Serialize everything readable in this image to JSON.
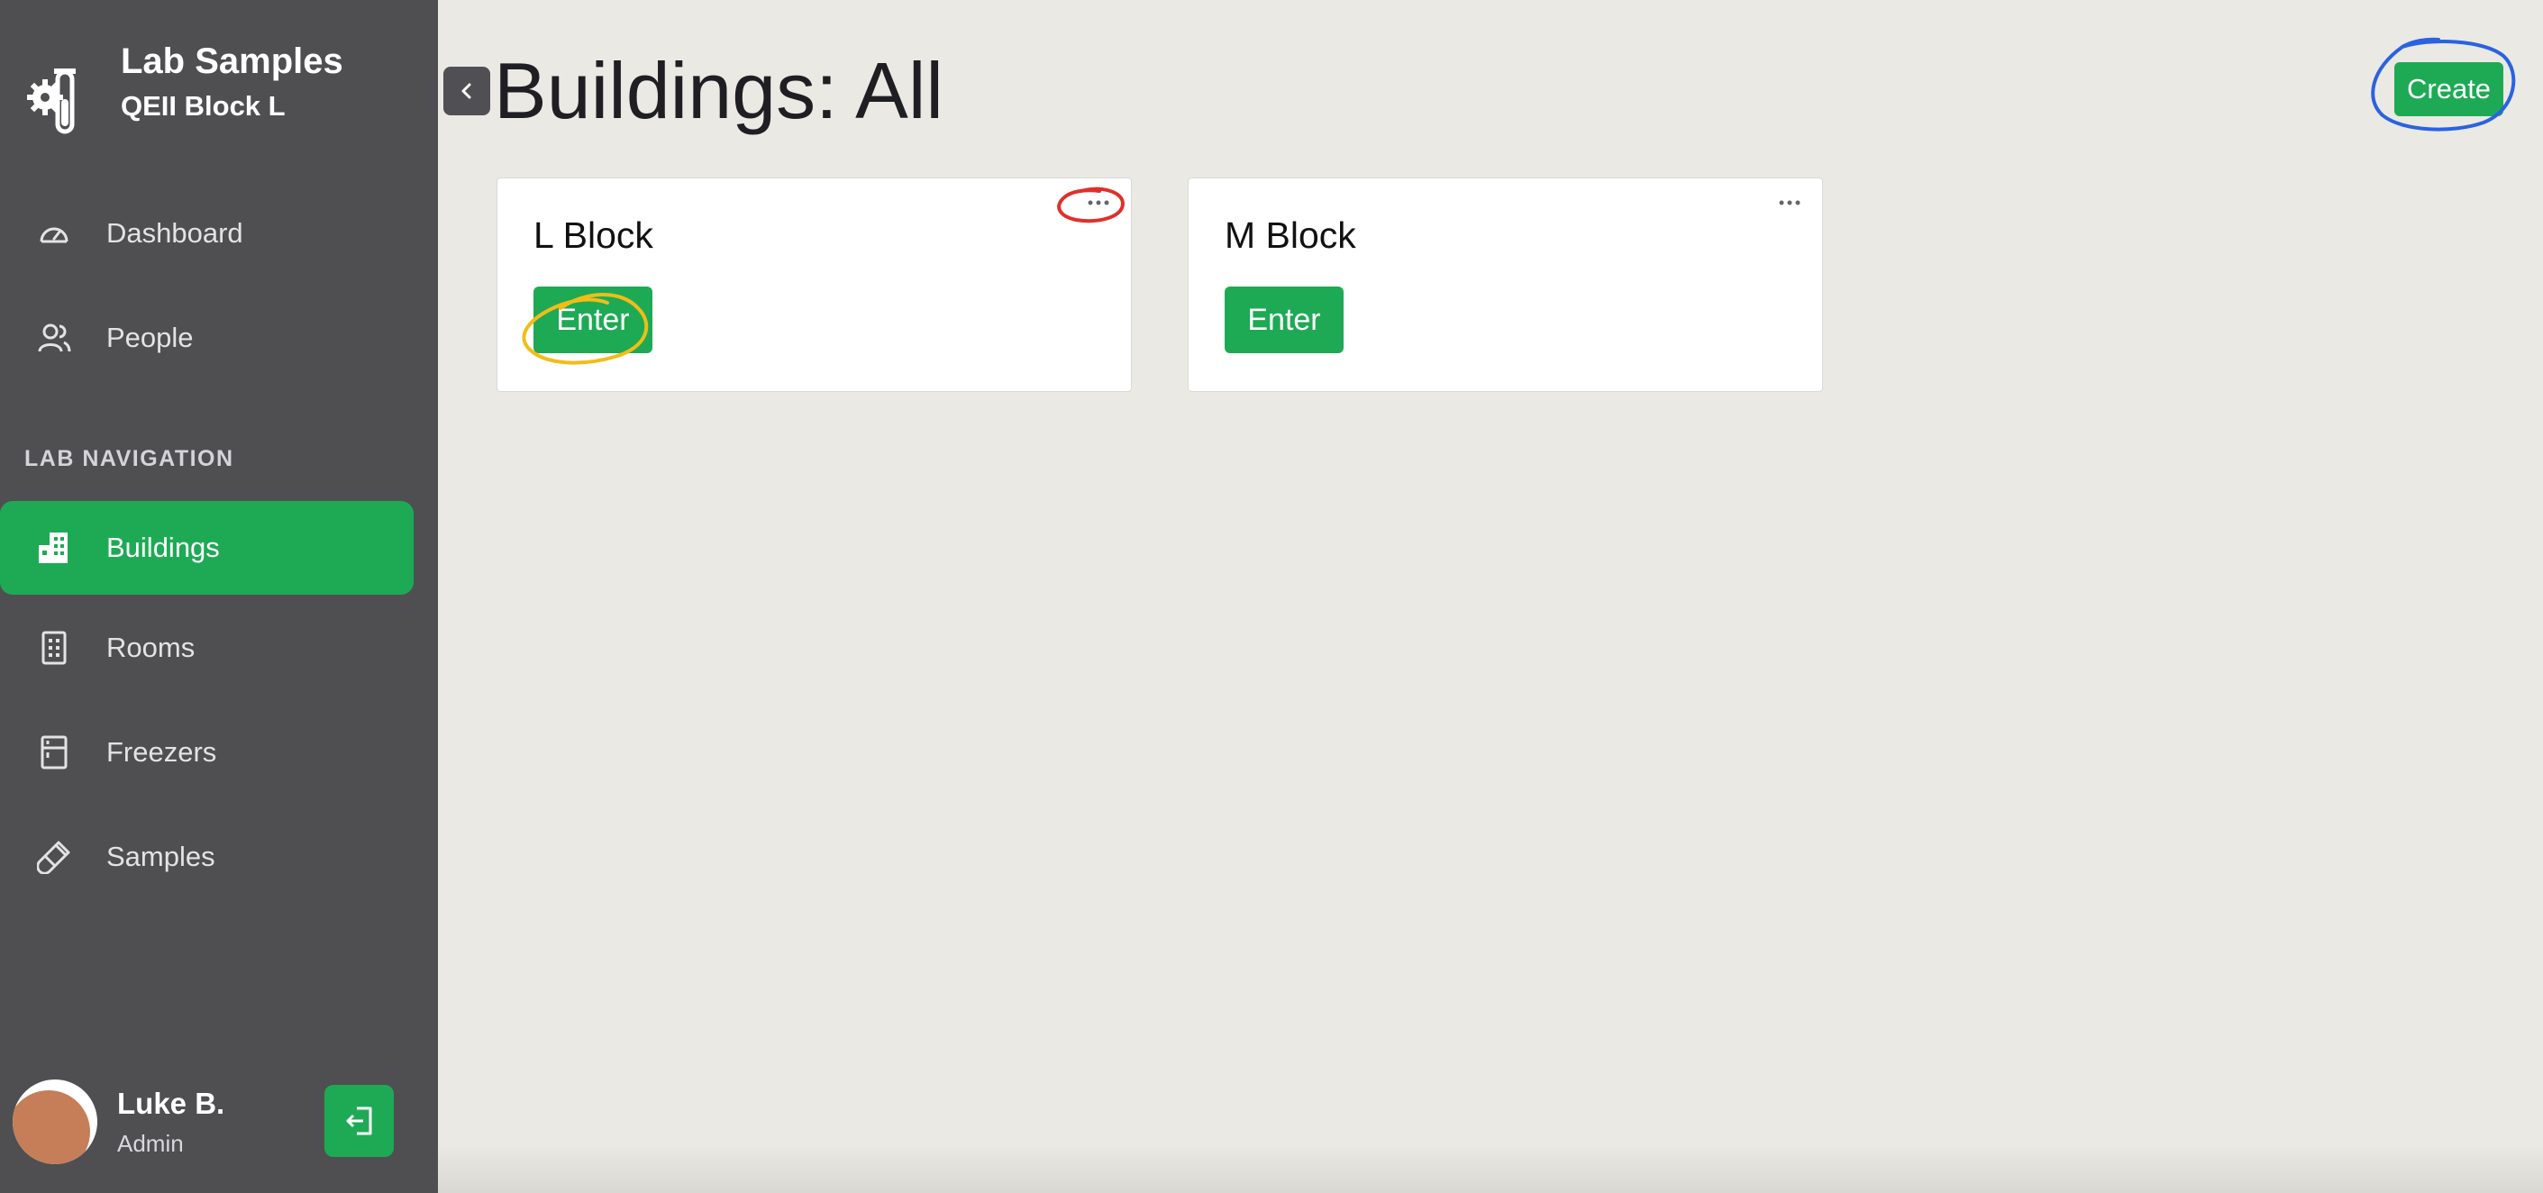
{
  "brand": {
    "title": "Lab Samples",
    "subtitle": "QEII Block L"
  },
  "nav": {
    "dashboard": "Dashboard",
    "people": "People",
    "section_label": "LAB NAVIGATION",
    "buildings": "Buildings",
    "rooms": "Rooms",
    "freezers": "Freezers",
    "samples": "Samples"
  },
  "user": {
    "name": "Luke B.",
    "role": "Admin"
  },
  "page": {
    "title": "Buildings: All",
    "create_label": "Create"
  },
  "cards": [
    {
      "title": "L Block",
      "enter_label": "Enter"
    },
    {
      "title": "M Block",
      "enter_label": "Enter"
    }
  ],
  "colors": {
    "accent": "#1eaa55",
    "sidebar": "#4f4f52",
    "background": "#ebe9e4"
  },
  "icons": {
    "brand": "lab-flask-gear-icon",
    "dashboard": "gauge-icon",
    "people": "people-icon",
    "buildings": "building-icon",
    "rooms": "room-icon",
    "freezers": "freezer-icon",
    "samples": "test-tube-icon",
    "logout": "logout-icon",
    "collapse": "chevron-left-icon",
    "more": "more-dots-icon"
  }
}
